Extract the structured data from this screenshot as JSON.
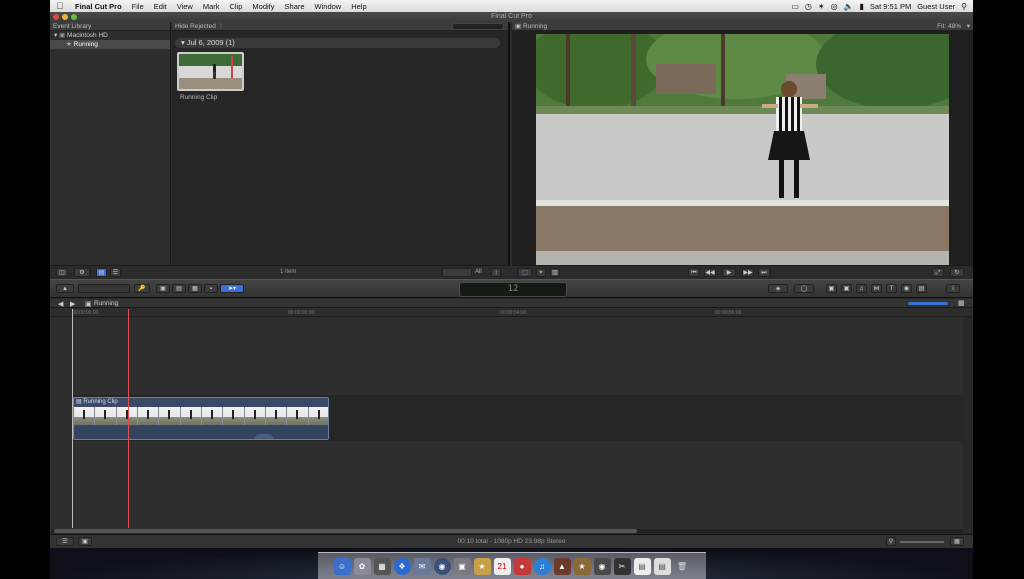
{
  "menubar": {
    "apple": "",
    "app": "Final Cut Pro",
    "items": [
      "File",
      "Edit",
      "View",
      "Mark",
      "Clip",
      "Modify",
      "Share",
      "Window",
      "Help"
    ],
    "clock": "Sat 9:51 PM",
    "user": "Guest User"
  },
  "window": {
    "title": "Final Cut Pro"
  },
  "event_library": {
    "header": "Event Library",
    "drive": "Macintosh HD",
    "event": "Running"
  },
  "browser": {
    "filter": "Hide Rejected",
    "date_group": "Jul 6, 2009  (1)",
    "clip_name": "Running Clip",
    "item_count": "1 item",
    "duration_label": "All"
  },
  "viewer": {
    "title": "Running",
    "fit": "Fit:  48%"
  },
  "toolbar": {
    "timecode": "12"
  },
  "timeline": {
    "project": "Running",
    "ruler_marks": [
      "00:00:00:00",
      "00:00:02:00",
      "00:00:04:00",
      "00:00:06:00"
    ],
    "clip_label": "Running Clip"
  },
  "status": {
    "text": "00:10 total - 1080p HD 23.98p Stereo"
  },
  "colors": {
    "playhead": "#e05050",
    "clip": "#3a4a66",
    "accent": "#3d6fd6"
  }
}
